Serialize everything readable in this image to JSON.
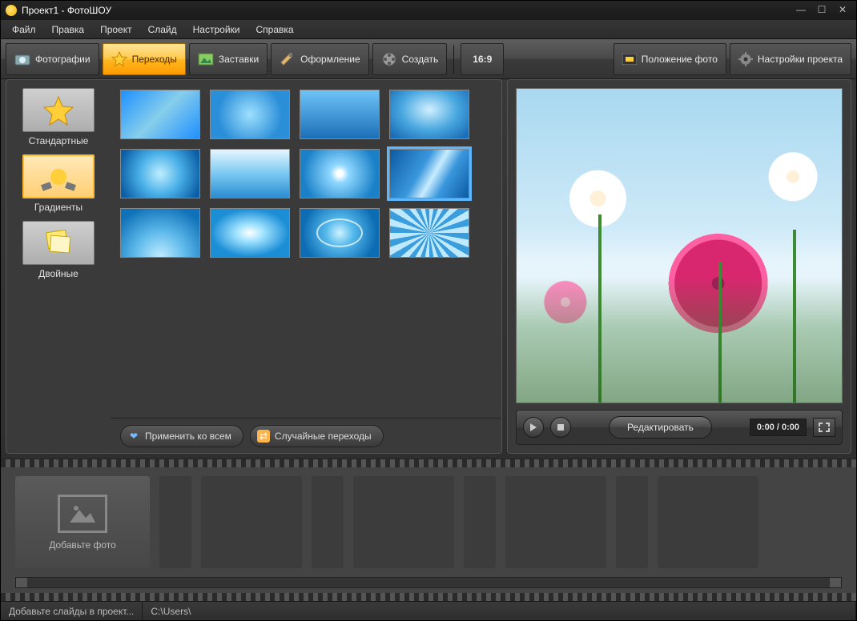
{
  "app": {
    "title": "Проект1 - ФотоШОУ"
  },
  "menu": [
    "Файл",
    "Правка",
    "Проект",
    "Слайд",
    "Настройки",
    "Справка"
  ],
  "toolbar": {
    "tabs": [
      {
        "id": "photos",
        "label": "Фотографии"
      },
      {
        "id": "transitions",
        "label": "Переходы",
        "active": true
      },
      {
        "id": "intros",
        "label": "Заставки"
      },
      {
        "id": "design",
        "label": "Оформление"
      },
      {
        "id": "create",
        "label": "Создать"
      }
    ],
    "aspect": "16:9",
    "position_btn": "Положение фото",
    "project_settings_btn": "Настройки проекта"
  },
  "categories": [
    {
      "id": "standard",
      "label": "Стандартные",
      "selected": false
    },
    {
      "id": "gradients",
      "label": "Градиенты",
      "selected": true
    },
    {
      "id": "double",
      "label": "Двойные",
      "selected": false
    }
  ],
  "actions": {
    "apply_all": "Применить ко всем",
    "random": "Случайные переходы"
  },
  "preview": {
    "edit_btn": "Редактировать",
    "timecode": "0:00 / 0:00"
  },
  "timeline": {
    "add_photo_label": "Добавьте фото"
  },
  "status": {
    "hint": "Добавьте слайды в проект...",
    "path": "C:\\Users\\"
  }
}
